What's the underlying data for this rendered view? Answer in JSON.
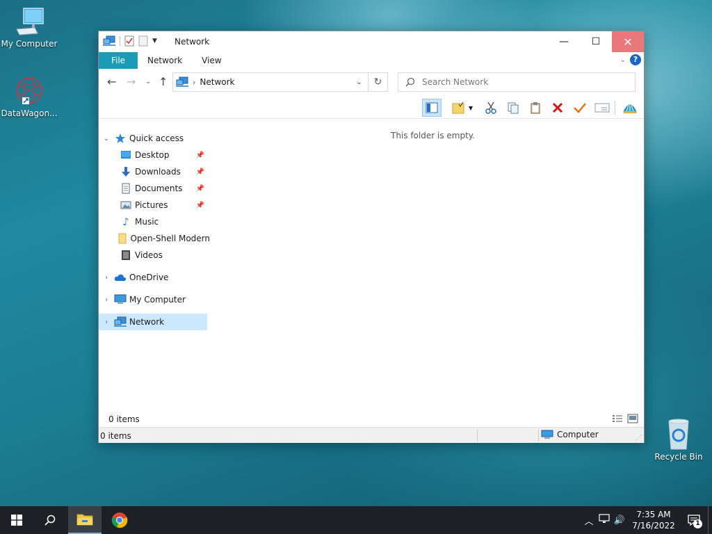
{
  "desktop": {
    "icons": [
      {
        "label": "My Computer"
      },
      {
        "label": "DataWagon..."
      },
      {
        "label": "Recycle Bin"
      }
    ]
  },
  "window": {
    "title": "Network",
    "controls": {
      "minimize": "—",
      "maximize": "☐",
      "close": "✕"
    },
    "ribbon": {
      "tabs": [
        {
          "label": "File"
        },
        {
          "label": "Network"
        },
        {
          "label": "View"
        }
      ],
      "help": "?"
    },
    "address": {
      "crumb": "Network",
      "search_placeholder": "Search Network"
    },
    "nav_pane": {
      "quick_access": "Quick access",
      "quick_items": [
        {
          "label": "Desktop",
          "pinned": true
        },
        {
          "label": "Downloads",
          "pinned": true
        },
        {
          "label": "Documents",
          "pinned": true
        },
        {
          "label": "Pictures",
          "pinned": true
        },
        {
          "label": "Music",
          "pinned": false
        },
        {
          "label": "Open-Shell Modern",
          "pinned": false
        },
        {
          "label": "Videos",
          "pinned": false
        }
      ],
      "roots": [
        {
          "label": "OneDrive"
        },
        {
          "label": "My Computer"
        },
        {
          "label": "Network",
          "selected": true
        }
      ]
    },
    "content": {
      "empty_message": "This folder is empty."
    },
    "status": {
      "item_count": "0 items",
      "bottom_count": "0 items",
      "zone": "Computer"
    }
  },
  "taskbar": {
    "time": "7:35 AM",
    "date": "7/16/2022",
    "notification_count": "1"
  },
  "colors": {
    "accent": "#1c9bb6",
    "selection": "#cce8ff",
    "close_hover": "#e8787a",
    "taskbar": "#1d2126"
  }
}
